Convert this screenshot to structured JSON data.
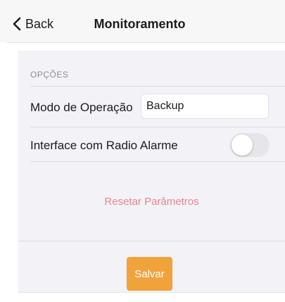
{
  "navbar": {
    "back_label": "Back",
    "title": "Monitoramento"
  },
  "options": {
    "section_header": "OPÇÕES",
    "operation_mode": {
      "label": "Modo de Operação",
      "value": "Backup"
    },
    "radio_alarm": {
      "label": "Interface com Radio Alarme",
      "enabled": false
    },
    "reset_label": "Resetar Parâmetros"
  },
  "actions": {
    "save_label": "Salvar"
  },
  "colors": {
    "accent_save": "#f1a33b",
    "reset_text": "#e8888b",
    "panel_bg": "#f2f2f7"
  },
  "icons": {
    "back": "chevron-left-icon"
  }
}
